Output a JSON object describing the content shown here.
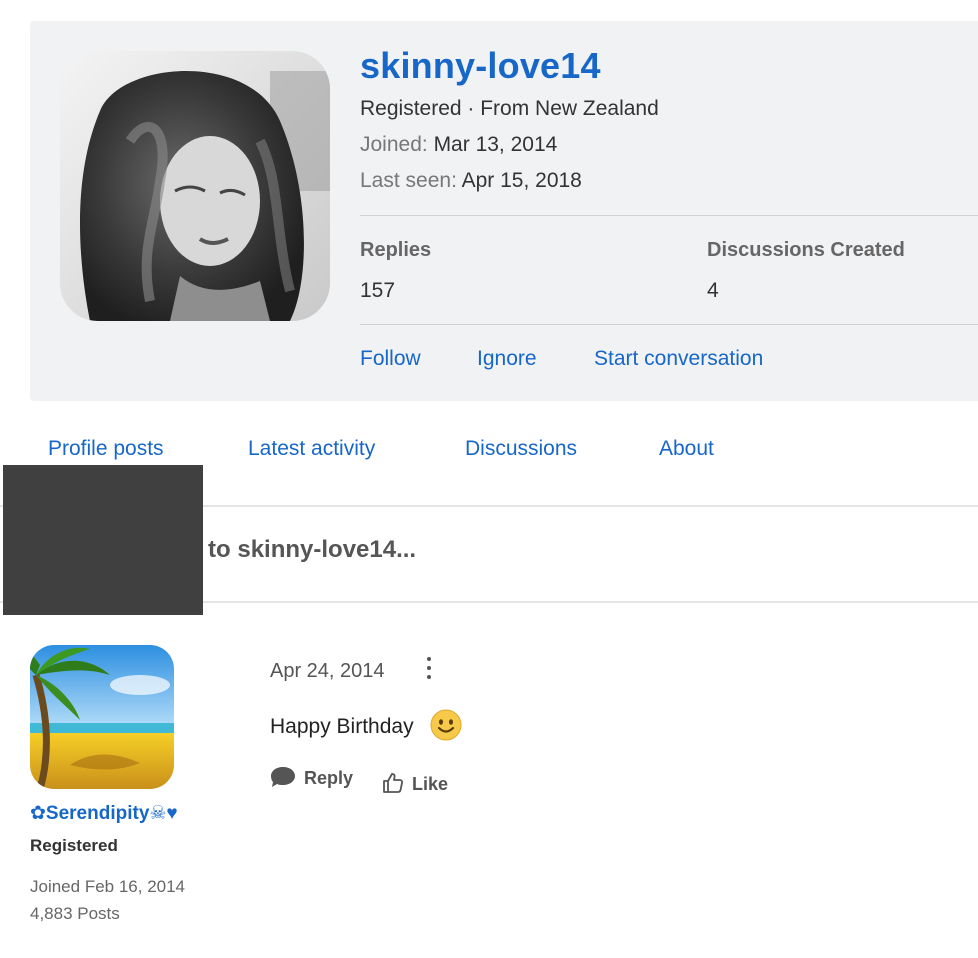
{
  "profile": {
    "username": "skinny-love14",
    "status_line": "Registered · From New Zealand",
    "joined_label": "Joined:",
    "joined_value": "Mar 13, 2014",
    "last_seen_label": "Last seen:",
    "last_seen_value": "Apr 15, 2018",
    "stats": {
      "replies_label": "Replies",
      "replies_value": "157",
      "discussions_label": "Discussions Created",
      "discussions_value": "4"
    },
    "actions": {
      "follow": "Follow",
      "ignore": "Ignore",
      "start_conversation": "Start conversation"
    }
  },
  "tabs": [
    "Profile posts",
    "Latest activity",
    "Discussions",
    "About"
  ],
  "write_prompt": "e something to skinny-love14...",
  "post": {
    "author": "✿Serendipity☠♥",
    "role": "Registered",
    "joined": "Joined Feb 16, 2014",
    "posts": "4,883 Posts",
    "date": "Apr 24, 2014",
    "text": "Happy Birthday",
    "reply_label": "Reply",
    "like_label": "Like"
  },
  "colors": {
    "link": "#1767c8",
    "card_bg": "#f1f2f4",
    "redaction": "#404040"
  }
}
